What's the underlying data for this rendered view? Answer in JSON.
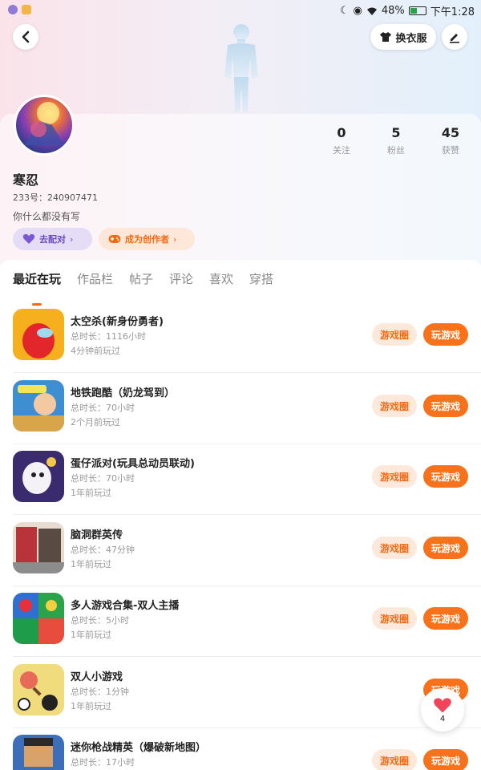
{
  "status_bar": {
    "battery": "48%",
    "time": "下午1:28",
    "battery_level": 0.48
  },
  "header": {
    "outfit_label": "换衣服"
  },
  "profile": {
    "name": "寒忍",
    "uid": "233号：240907471",
    "bio": "你什么都没有写",
    "stats": [
      {
        "value": "0",
        "label": "关注"
      },
      {
        "value": "5",
        "label": "粉丝"
      },
      {
        "value": "45",
        "label": "获赞"
      }
    ],
    "match_label": "去配对",
    "creator_label": "成为创作者"
  },
  "tabs": [
    "最近在玩",
    "作品栏",
    "帖子",
    "评论",
    "喜欢",
    "穿搭"
  ],
  "game_buttons": {
    "circle": "游戏圈",
    "play": "玩游戏"
  },
  "games": [
    {
      "name": "太空杀(新身份勇者)",
      "duration": "总时长：1116小时",
      "last": "4分钟前玩过"
    },
    {
      "name": "地铁跑酷（奶龙驾到）",
      "duration": "总时长：70小时",
      "last": "2个月前玩过"
    },
    {
      "name": "蛋仔派对(玩具总动员联动)",
      "duration": "总时长：70小时",
      "last": "1年前玩过"
    },
    {
      "name": "脑洞群英传",
      "duration": "总时长：47分钟",
      "last": "1年前玩过"
    },
    {
      "name": "多人游戏合集-双人主播",
      "duration": "总时长：5小时",
      "last": "1年前玩过"
    },
    {
      "name": "双人小游戏",
      "duration": "总时长：1分钟",
      "last": "1年前玩过"
    },
    {
      "name": "迷你枪战精英（爆破新地图）",
      "duration": "总时长：17小时",
      "last": ""
    }
  ],
  "like_fab": {
    "count": "4"
  },
  "colors": {
    "accent": "#f7721b",
    "accent_soft": "#fde9dc",
    "match_purple": "#6a4bc4"
  }
}
